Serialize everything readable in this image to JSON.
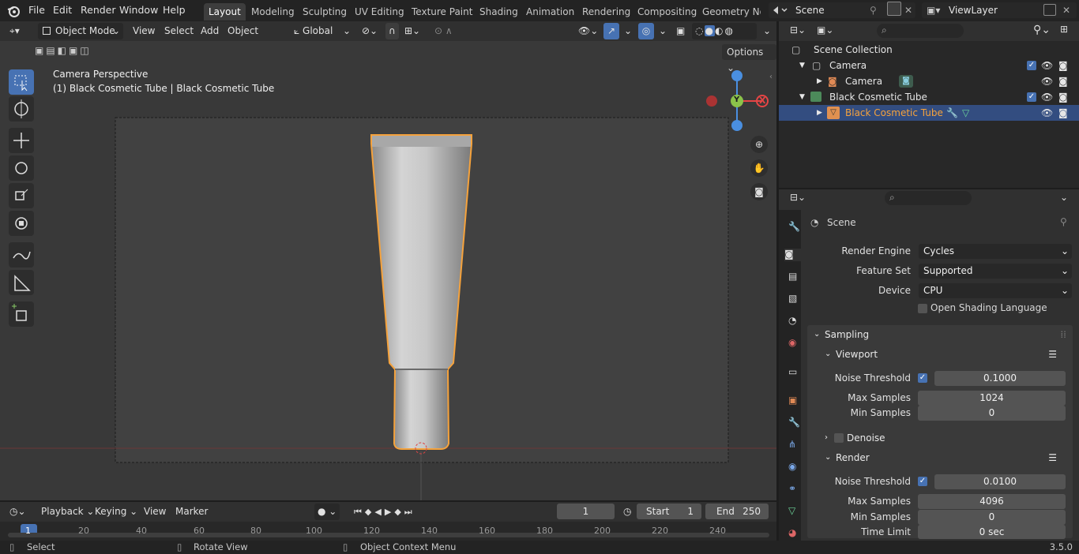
{
  "menus": [
    "File",
    "Edit",
    "Render",
    "Window",
    "Help"
  ],
  "workspaces": [
    "Layout",
    "Modeling",
    "Sculpting",
    "UV Editing",
    "Texture Paint",
    "Shading",
    "Animation",
    "Rendering",
    "Compositing",
    "Geometry Noc"
  ],
  "scene_name": "Scene",
  "viewlayer_name": "ViewLayer",
  "viewport_header": {
    "mode": "Object Mode",
    "view": "View",
    "select": "Select",
    "add": "Add",
    "object": "Object",
    "orientation": "Global",
    "options": "Options"
  },
  "viewport": {
    "title": "Camera Perspective",
    "subtitle": "(1) Black Cosmetic Tube | Black Cosmetic Tube",
    "gizmo_y": "Y",
    "gizmo_x": "X"
  },
  "outliner": {
    "root": "Scene Collection",
    "items": [
      {
        "label": "Camera"
      },
      {
        "label": "Camera"
      },
      {
        "label": "Black Cosmetic Tube"
      },
      {
        "label": "Black Cosmetic Tube"
      }
    ]
  },
  "properties": {
    "context": "Scene",
    "render_engine_label": "Render Engine",
    "render_engine": "Cycles",
    "feature_set_label": "Feature Set",
    "feature_set": "Supported",
    "device_label": "Device",
    "device": "CPU",
    "osl_label": "Open Shading Language",
    "sampling": "Sampling",
    "viewport_panel": "Viewport",
    "vp_noise_label": "Noise Threshold",
    "vp_noise": "0.1000",
    "vp_max_label": "Max Samples",
    "vp_max": "1024",
    "vp_min_label": "Min Samples",
    "vp_min": "0",
    "denoise": "Denoise",
    "render_panel": "Render",
    "r_noise_label": "Noise Threshold",
    "r_noise": "0.0100",
    "r_max_label": "Max Samples",
    "r_max": "4096",
    "r_min_label": "Min Samples",
    "r_min": "0",
    "time_limit_label": "Time Limit",
    "time_limit": "0 sec"
  },
  "timeline": {
    "playback": "Playback",
    "keying": "Keying",
    "view": "View",
    "marker": "Marker",
    "current_frame": "1",
    "start_label": "Start",
    "start": "1",
    "end_label": "End",
    "end": "250",
    "ticks": [
      "1",
      "20",
      "40",
      "60",
      "80",
      "100",
      "120",
      "140",
      "160",
      "180",
      "200",
      "220",
      "240"
    ]
  },
  "status": {
    "select": "Select",
    "rotate": "Rotate View",
    "context_menu": "Object Context Menu",
    "version": "3.5.0"
  },
  "colors": {
    "accent": "#4772b3",
    "selection_orange": "#f5a23c",
    "gizmo_x": "#e64545",
    "gizmo_y": "#8bc34a",
    "gizmo_z": "#4a8fe0"
  }
}
